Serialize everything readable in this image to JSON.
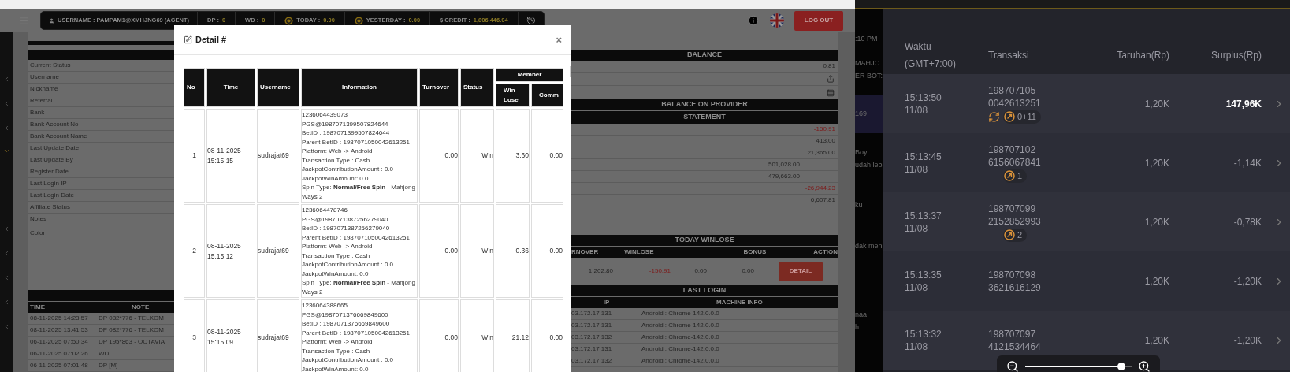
{
  "header": {
    "user": "USERNAME : PAMPAM1@XMHJNG69 (AGENT)",
    "stats": [
      {
        "kind": "plain",
        "label": "DP :",
        "value": "0"
      },
      {
        "kind": "plain",
        "label": "WD :",
        "value": "0"
      },
      {
        "kind": "coin",
        "label": "TODAY :",
        "value": "0.00"
      },
      {
        "kind": "coin",
        "label": "YESTERDAY :",
        "value": "0.00"
      },
      {
        "kind": "plain",
        "label": "$ CREDIT :",
        "value": "1,806,446.04"
      }
    ],
    "logout": "LOG OUT"
  },
  "sidebar": {
    "items": [
      {
        "expanded": false
      },
      {
        "expanded": false
      },
      {
        "expanded": false
      },
      {
        "expanded": true
      },
      {
        "expanded": false
      },
      {
        "expanded": false
      },
      {
        "expanded": false
      },
      {
        "expanded": false
      },
      {
        "expanded": false
      }
    ]
  },
  "profile": {
    "labels": [
      "Current Status",
      "Username",
      "Nickname",
      "Referral",
      "Bank",
      "Bank Account No",
      "Bank Account Name",
      "Last Update Date",
      "Last Update By",
      "Register Date",
      "Last Login IP",
      "Last Login Date",
      "Affiliate Status",
      "Notes",
      "Color"
    ]
  },
  "log_table": {
    "columns": [
      "TIME",
      "NOTE"
    ],
    "rows": [
      [
        "08-11-2025 14:23:57",
        "DP 082*776 - TELKOM"
      ],
      [
        "08-11-2025 13:41:53",
        "DP 082*776 - TELKOM"
      ],
      [
        "06-11-2025 07:50:34",
        "DP 195*863 - OCTAVIA"
      ],
      [
        "06-11-2025 07:02:26",
        "WD"
      ],
      [
        "06-11-2025 07:01:48",
        "DP [M]"
      ]
    ]
  },
  "balance": {
    "title": "BALANCE",
    "value": "0.81",
    "provider_title": "BALANCE ON PROVIDER",
    "statement_title": "STATEMENT",
    "statement": [
      {
        "kind": "total",
        "value": "-150.91",
        "negative": true
      },
      {
        "kind": "total",
        "value": "413.00",
        "negative": false
      },
      {
        "kind": "total",
        "value": "21,365.00",
        "negative": false
      },
      {
        "kind": "sub",
        "value": "501,028.00",
        "negative": false
      },
      {
        "kind": "sub",
        "value": "479,663.00",
        "negative": false
      },
      {
        "kind": "total",
        "value": "-26,944.23",
        "negative": true
      },
      {
        "kind": "total",
        "value": "6,607.81",
        "negative": false
      }
    ]
  },
  "today_winlose": {
    "title": "TODAY WINLOSE",
    "columns": [
      "RNOVER",
      "WINLOSE",
      "BONUS",
      "ACTION"
    ],
    "row": [
      {
        "value": "1,202.80",
        "negative": false
      },
      {
        "value": "-150.91",
        "negative": true
      },
      {
        "value": "0.00",
        "negative": false
      },
      {
        "value": "0.00",
        "negative": false
      }
    ],
    "action": "DETAIL"
  },
  "last_login": {
    "title": "LAST LOGIN",
    "columns": [
      "IP",
      "MACHINE INFO"
    ],
    "rows": [
      [
        "03.172.17.131",
        "Android : Chrome-142.0.0.0"
      ],
      [
        "03.172.17.131",
        "Android : Chrome-142.0.0.0"
      ],
      [
        "03.172.17.132",
        "Android : Chrome-142.0.0.0"
      ],
      [
        "03.172.17.131",
        "Android : Chrome-142.0.0.0"
      ],
      [
        "03.172.17.132",
        "Android : Chrome-142.0.0.0"
      ]
    ]
  },
  "modal": {
    "title": "Detail #",
    "close": "×",
    "columns": [
      "No",
      "Time",
      "Username",
      "Information",
      "Turnover",
      "Status"
    ],
    "group": "Member",
    "subcolumns": [
      "Win Lose",
      "Comm"
    ],
    "rows": [
      {
        "no": "1",
        "time": [
          "08-11-2025",
          "15:15:15"
        ],
        "username": "sudrajat69",
        "info": [
          "1236064439073",
          "PGS@1987071399507824644",
          "BetID : 1987071399507824644",
          "Parent BetID : 1987071050042613251",
          "Platform: Web -> Android",
          "Transaction Type : Cash",
          "JackpotContributionAmount : 0.0",
          "JackpotWinAmount: 0.0",
          "Spin Type: **Normal/Free Spin** - Mahjong Ways 2"
        ],
        "turnover": "0.00",
        "status": "Win",
        "winlose": "3.60",
        "comm": "0.00"
      },
      {
        "no": "2",
        "time": [
          "08-11-2025",
          "15:15:12"
        ],
        "username": "sudrajat69",
        "info": [
          "1236064478746",
          "PGS@1987071387256279040",
          "BetID : 1987071387256279040",
          "Parent BetID : 1987071050042613251",
          "Platform: Web -> Android",
          "Transaction Type : Cash",
          "JackpotContributionAmount : 0.0",
          "JackpotWinAmount: 0.0",
          "Spin Type: **Normal/Free Spin** - Mahjong Ways 2"
        ],
        "turnover": "0.00",
        "status": "Win",
        "winlose": "0.36",
        "comm": "0.00"
      },
      {
        "no": "3",
        "time": [
          "08-11-2025",
          "15:15:09"
        ],
        "username": "sudrajat69",
        "info": [
          "1236064388665",
          "PGS@1987071376669849600",
          "BetID : 1987071376669849600",
          "Parent BetID : 1987071050042613251",
          "Platform: Web -> Android",
          "Transaction Type : Cash",
          "JackpotContributionAmount : 0.0",
          "JackpotWinAmount: 0.0"
        ],
        "turnover": "0.00",
        "status": "Win",
        "winlose": "21.12",
        "comm": "0.00"
      }
    ]
  },
  "chat_strip": [
    {
      "text": ":10 PM",
      "highlighted": false
    },
    {
      "text": "MAHJO",
      "highlighted": false
    },
    {
      "text": "ER BOT:",
      "highlighted": false
    },
    {
      "text": "169",
      "highlighted": true
    },
    {
      "text": "Boy",
      "highlighted": false
    },
    {
      "text": "udah leb",
      "highlighted": false
    },
    {
      "text": "ku",
      "highlighted": false
    },
    {
      "text": "dak men",
      "highlighted": false
    },
    {
      "text": "naa",
      "highlighted": false
    },
    {
      "text": "h",
      "highlighted": false
    }
  ],
  "history": {
    "columns": [
      "Waktu\n(GMT+7:00)",
      "Transaksi",
      "Taruhan(Rp)",
      "Surplus(Rp)"
    ],
    "rows": [
      {
        "time": "15:13:50",
        "date": "11/08",
        "txn": [
          "198707105",
          "0042613251"
        ],
        "spin": true,
        "badges": [
          {
            "kind": "count",
            "text": "0+11"
          }
        ],
        "bet": "1,20K",
        "surplus": "147,96K",
        "highlight": true
      },
      {
        "time": "15:13:45",
        "date": "11/08",
        "txn": [
          "198707102",
          "6156067841"
        ],
        "spin": false,
        "badges": [
          {
            "kind": "count",
            "text": "1"
          }
        ],
        "bet": "1,20K",
        "surplus": "-1,14K",
        "highlight": false
      },
      {
        "time": "15:13:37",
        "date": "11/08",
        "txn": [
          "198707099",
          "2152852993"
        ],
        "spin": false,
        "badges": [
          {
            "kind": "count",
            "text": "2"
          }
        ],
        "bet": "1,20K",
        "surplus": "-0,78K",
        "highlight": false
      },
      {
        "time": "15:13:35",
        "date": "11/08",
        "txn": [
          "198707098",
          "3621616129"
        ],
        "badges": [],
        "bet": "1,20K",
        "surplus": "-1,20K",
        "highlight": false
      },
      {
        "time": "15:13:32",
        "date": "11/08",
        "txn": [
          "198707097",
          "4121534464"
        ],
        "badges": [],
        "bet": "1,20K",
        "surplus": "-1,20K",
        "highlight": false
      }
    ]
  },
  "zoom": {
    "level": 0.9
  }
}
